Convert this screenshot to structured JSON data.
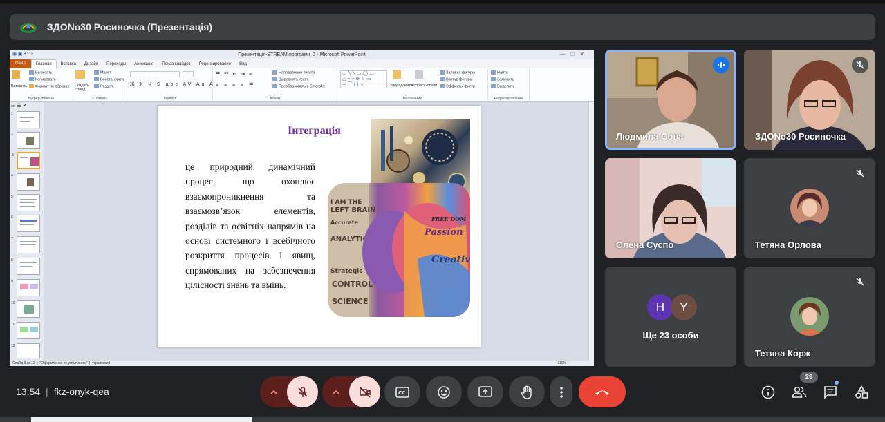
{
  "header": {
    "title": "ЗДОNo30 Росиночка (Презентація)"
  },
  "powerpoint": {
    "window_title": "Презентація-STREAM-програми_2 - Microsoft PowerPoint",
    "tabs": [
      "Файл",
      "Главная",
      "Вставка",
      "Дизайн",
      "Переходы",
      "Анимация",
      "Показ слайдов",
      "Рецензирование",
      "Вид"
    ],
    "ribbon": {
      "clipboard_caption": "Буфер обмена",
      "cut": "Вырезать",
      "copy": "Копировать",
      "paste": "Вставить",
      "format_painter": "Формат по образцу",
      "slides_caption": "Слайды",
      "create_slide": "Создать слайд",
      "layout": "Макет",
      "reset": "Восстановить",
      "section": "Раздел",
      "font_caption": "Шрифт",
      "paragraph_caption": "Абзац",
      "text_direction": "Направление текста",
      "align_text": "Выровнять текст",
      "smartart": "Преобразовать в SmartArt",
      "drawing_caption": "Рисование",
      "arrange": "Упорядочить",
      "quick_styles": "Экспресс-стили",
      "shape_fill": "Заливка фигуры",
      "shape_outline": "Контур фигуры",
      "shape_effects": "Эффекты фигур",
      "editing_caption": "Редактирование",
      "find": "Найти",
      "replace": "Заменить",
      "select": "Выделить"
    },
    "slide": {
      "title": "Інтеграція",
      "body": "це природний динамічний процес, що охоплює взаємопроникнення та взаємозв’язок елементів, розділів та освітніх напрямів на основі системного і всебічного розкриття процесів і явищ, спрямованих на забезпечення цілісності знань та вмінь."
    },
    "status": {
      "slide_info": "Слайд 3 из 12",
      "theme": "\"Оформление по умолчанию\"",
      "language": "украинский",
      "zoom": "110%"
    }
  },
  "participants": [
    {
      "name": "Людмила Сова",
      "state": "speaking"
    },
    {
      "name": "ЗДОNo30 Росиночка",
      "state": "muted"
    },
    {
      "name": "Олена Суспо",
      "state": "video"
    },
    {
      "name": "Тетяна Орлова",
      "state": "muted"
    },
    {
      "name": "Тетяна Корж",
      "state": "muted"
    }
  ],
  "more_tile": {
    "initials": [
      "H",
      "Y"
    ],
    "label": "Ще 23 особи"
  },
  "footer": {
    "time": "13:54",
    "meeting_code": "fkz-onyk-qea",
    "participant_count": "29"
  }
}
